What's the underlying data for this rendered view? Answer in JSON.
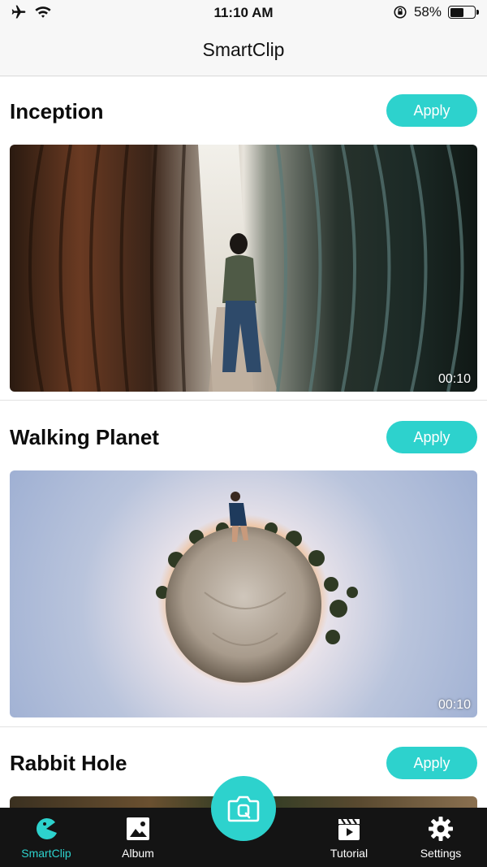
{
  "status_bar": {
    "time": "11:10 AM",
    "battery_percent": "58%",
    "battery_level": 0.58
  },
  "nav": {
    "title": "SmartClip"
  },
  "templates": [
    {
      "title": "Inception",
      "apply_label": "Apply",
      "duration": "00:10"
    },
    {
      "title": "Walking Planet",
      "apply_label": "Apply",
      "duration": "00:10"
    },
    {
      "title": "Rabbit Hole",
      "apply_label": "Apply"
    }
  ],
  "tabs": [
    {
      "label": "SmartClip",
      "icon": "pacman-icon",
      "active": true
    },
    {
      "label": "Album",
      "icon": "image-icon"
    },
    {
      "label": "Tutorial",
      "icon": "clapperboard-icon"
    },
    {
      "label": "Settings",
      "icon": "gear-icon"
    }
  ],
  "colors": {
    "accent": "#2dd2cd",
    "tab_bar": "#141414"
  }
}
